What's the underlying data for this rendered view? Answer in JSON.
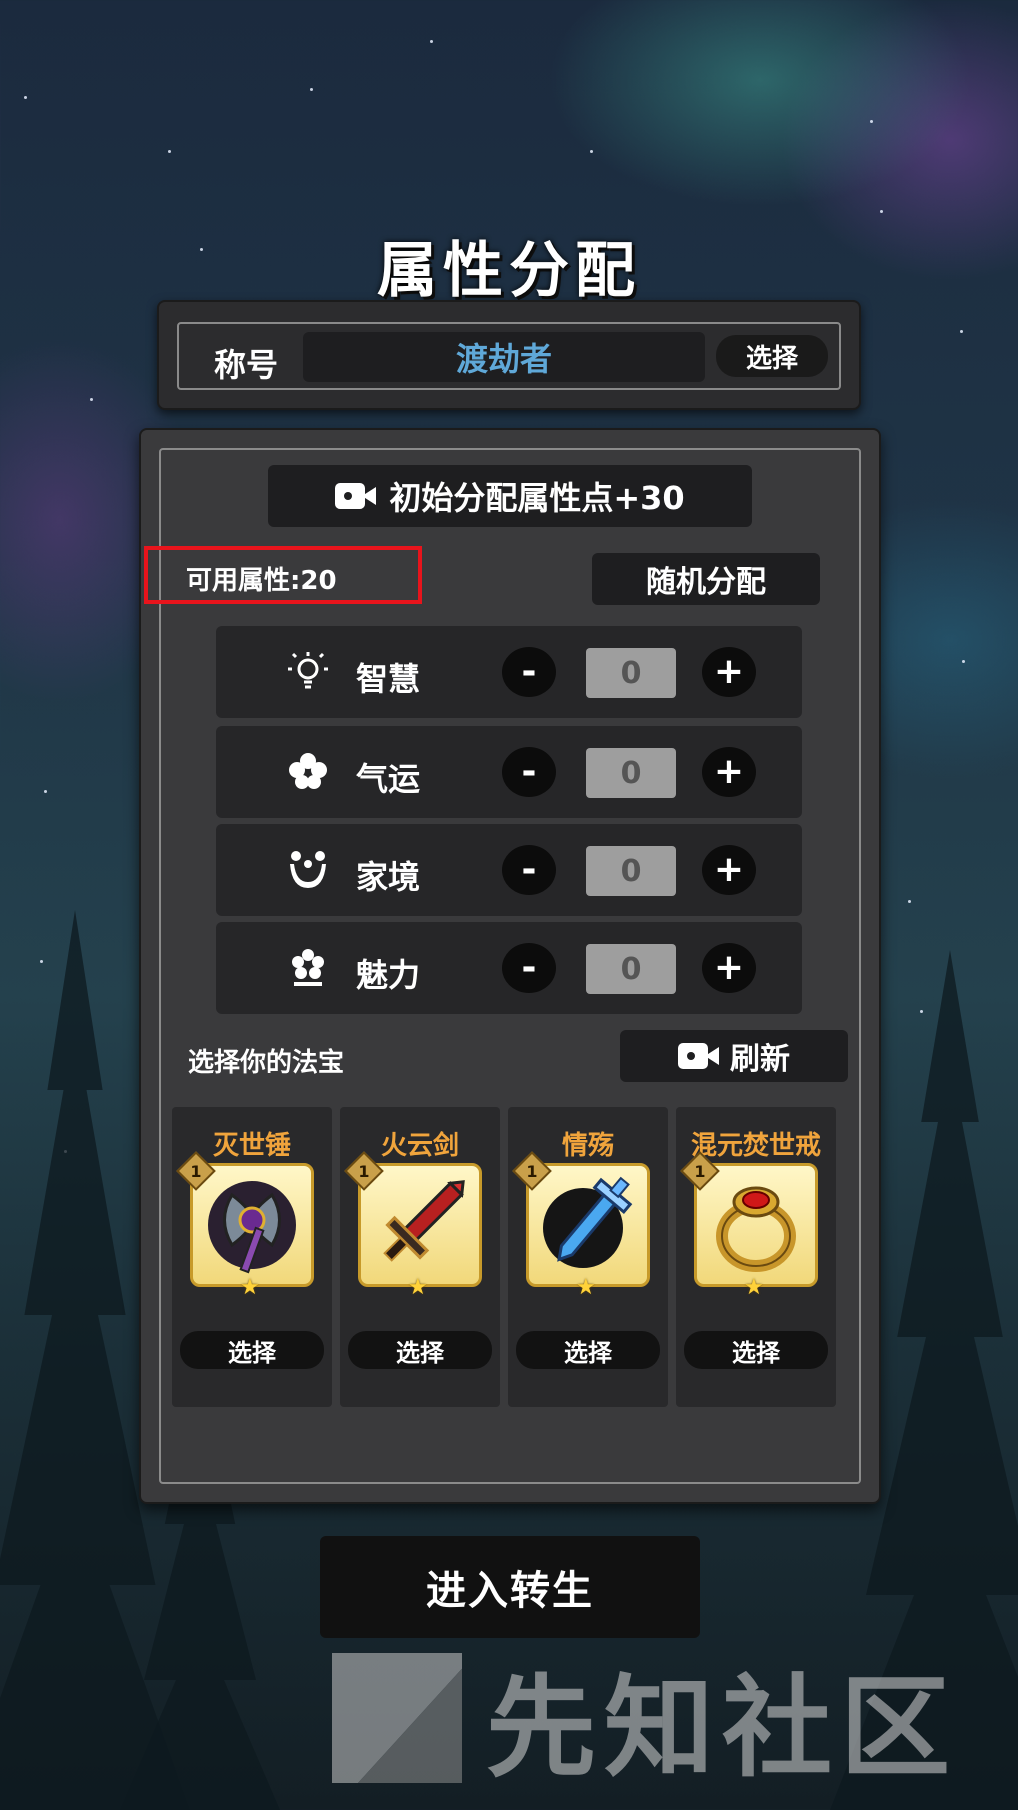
{
  "header": {
    "title": "属性分配"
  },
  "title_section": {
    "label": "称号",
    "value": "渡劫者",
    "select_label": "选择"
  },
  "initial_points_button": {
    "label": "初始分配属性点+30",
    "icon": "video-camera-icon"
  },
  "available": {
    "label": "可用属性:20"
  },
  "random_button": {
    "label": "随机分配"
  },
  "attributes": [
    {
      "name": "智慧",
      "icon": "lightbulb-icon",
      "value": "0",
      "minus": "-",
      "plus": "+"
    },
    {
      "name": "气运",
      "icon": "clover-icon",
      "value": "0",
      "minus": "-",
      "plus": "+"
    },
    {
      "name": "家境",
      "icon": "family-icon",
      "value": "0",
      "minus": "-",
      "plus": "+"
    },
    {
      "name": "魅力",
      "icon": "flower-icon",
      "value": "0",
      "minus": "-",
      "plus": "+"
    }
  ],
  "treasures": {
    "heading": "选择你的法宝",
    "refresh_label": "刷新",
    "items": [
      {
        "name": "灭世锤",
        "level": "1",
        "icon": "axe-icon",
        "select_label": "选择"
      },
      {
        "name": "火云剑",
        "level": "1",
        "icon": "fire-sword-icon",
        "select_label": "选择"
      },
      {
        "name": "情殇",
        "level": "1",
        "icon": "crystal-sword-icon",
        "select_label": "选择"
      },
      {
        "name": "混元焚世戒",
        "level": "1",
        "icon": "ring-icon",
        "select_label": "选择"
      }
    ]
  },
  "enter_button": {
    "label": "进入转生"
  },
  "watermark": {
    "text": "先知社区"
  },
  "colors": {
    "title_value": "#5fa8d8",
    "treasure_name": "#f0a43c",
    "highlight_border": "#e8141c"
  }
}
